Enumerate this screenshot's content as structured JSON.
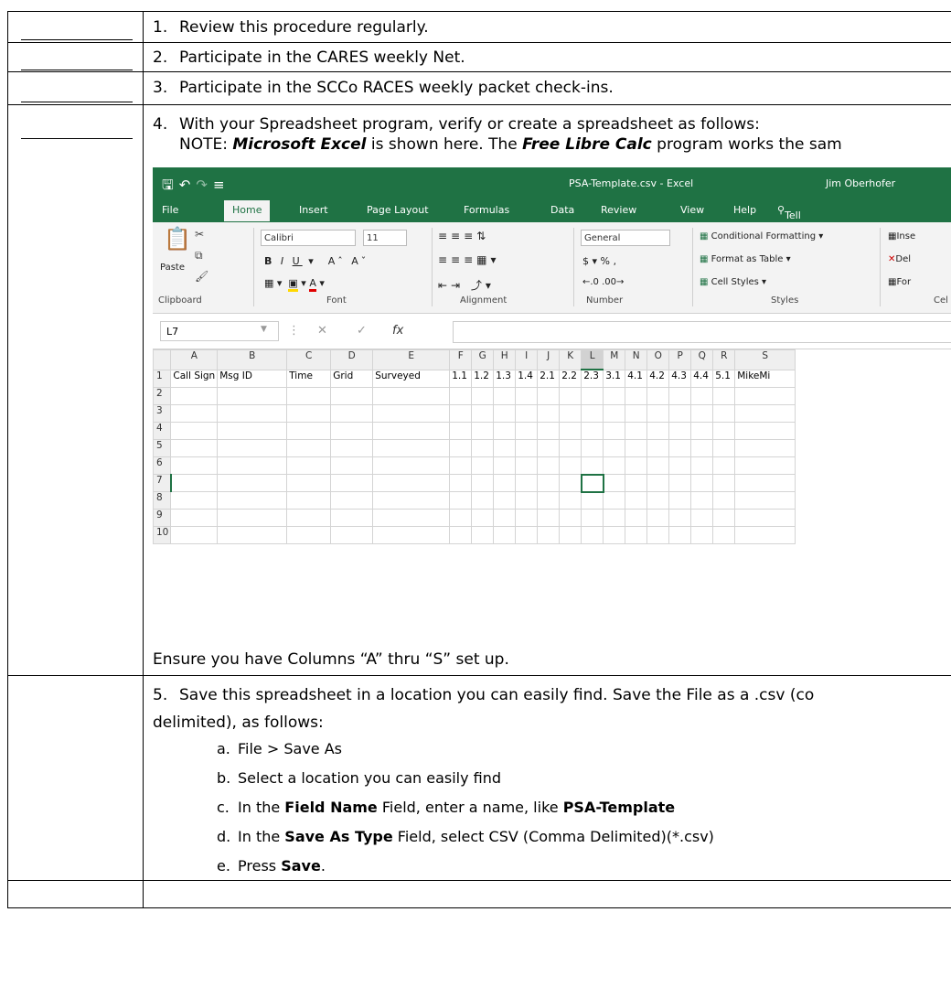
{
  "steps": [
    {
      "num": "1.",
      "text": "Review this procedure regularly."
    },
    {
      "num": "2.",
      "text": "Participate in the CARES weekly Net."
    },
    {
      "num": "3.",
      "text": "Participate in the SCCo RACES weekly packet check-ins."
    },
    {
      "num": "4.",
      "text": "With your Spreadsheet program, verify or create a spreadsheet as follows:"
    }
  ],
  "note": {
    "prefix": "NOTE: ",
    "app1": "Microsoft Excel",
    "mid": " is shown here. The ",
    "app2": "Free Libre Calc",
    "suffix": " program works the sam"
  },
  "excel": {
    "doc_title": "PSA-Template.csv  -  Excel",
    "user": "Jim Oberhofer",
    "tabs": [
      "File",
      "Home",
      "Insert",
      "Page Layout",
      "Formulas",
      "Data",
      "Review",
      "View",
      "Help",
      "Tell me"
    ],
    "font_name": "Calibri",
    "font_size": "11",
    "number_format": "General",
    "styles": [
      "Conditional Formatting",
      "Format as Table",
      "Cell Styles"
    ],
    "cells_items": [
      "Inse",
      "Del",
      "For"
    ],
    "group_labels": [
      "Clipboard",
      "Font",
      "Alignment",
      "Number",
      "Styles",
      "Cel"
    ],
    "paste_label": "Paste",
    "name_box": "L7",
    "fx_label": "fx",
    "column_headers": [
      "A",
      "B",
      "C",
      "D",
      "E",
      "F",
      "G",
      "H",
      "I",
      "J",
      "K",
      "L",
      "M",
      "N",
      "O",
      "P",
      "Q",
      "R",
      "S"
    ],
    "row1": [
      "Call Sign",
      "Msg ID",
      "Time",
      "Grid",
      "Surveyed",
      "1.1",
      "1.2",
      "1.3",
      "1.4",
      "2.1",
      "2.2",
      "2.3",
      "3.1",
      "4.1",
      "4.2",
      "4.3",
      "4.4",
      "5.1",
      "MikeMi"
    ],
    "row_numbers": [
      "1",
      "2",
      "3",
      "4",
      "5",
      "6",
      "7",
      "8",
      "9",
      "10"
    ],
    "selected_cell": "L7"
  },
  "columns_note": "Ensure you have Columns “A” thru “S” set up.",
  "step5": {
    "num": "5.",
    "line1": "Save this spreadsheet in a location you can easily find.  Save the File as a .csv (co",
    "line2": "delimited), as follows:",
    "substeps": [
      {
        "letter": "a.",
        "parts": [
          [
            "File > Save As",
            false
          ]
        ]
      },
      {
        "letter": "b.",
        "parts": [
          [
            "Select a location you can easily find",
            false
          ]
        ]
      },
      {
        "letter": "c.",
        "parts": [
          [
            "In the ",
            false
          ],
          [
            "Field Name",
            true
          ],
          [
            " Field, enter a name, like ",
            false
          ],
          [
            "PSA-Template",
            true
          ]
        ]
      },
      {
        "letter": "d.",
        "parts": [
          [
            "In the ",
            false
          ],
          [
            "Save As Type",
            true
          ],
          [
            " Field, select CSV (Comma Delimited)(*.csv)",
            false
          ]
        ]
      },
      {
        "letter": "e.",
        "parts": [
          [
            "Press ",
            false
          ],
          [
            "Save",
            true
          ],
          [
            ".",
            false
          ]
        ]
      }
    ]
  }
}
